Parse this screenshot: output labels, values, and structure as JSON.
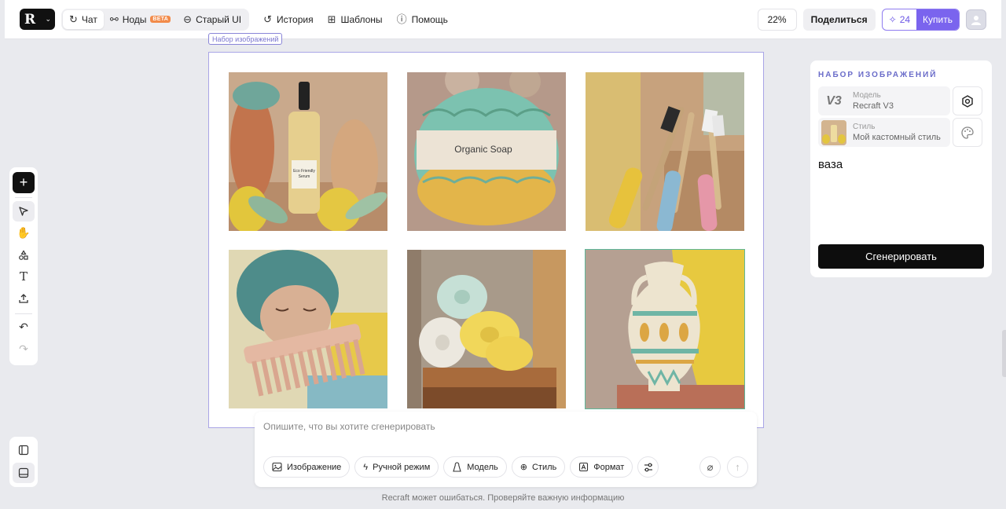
{
  "topbar": {
    "logo_letter": "R",
    "tabs": [
      {
        "label": "Чат",
        "icon": "refresh-icon",
        "active": true
      },
      {
        "label": "Ноды",
        "icon": "nodes-icon",
        "badge": "BETA"
      },
      {
        "label": "Старый UI",
        "icon": "minus-circle-icon"
      }
    ],
    "nav": [
      {
        "label": "История",
        "icon": "history-icon"
      },
      {
        "label": "Шаблоны",
        "icon": "grid-icon"
      },
      {
        "label": "Помощь",
        "icon": "help-icon"
      }
    ],
    "zoom": "22%",
    "share_label": "Поделиться",
    "credits": "24",
    "buy_label": "Купить"
  },
  "canvas": {
    "frame_label": "Набор изображений",
    "tiles": [
      {
        "name": "serum",
        "label": "Eco Friendly Serum"
      },
      {
        "name": "soap",
        "label": "Organic Soap"
      },
      {
        "name": "toothbrushes"
      },
      {
        "name": "comb"
      },
      {
        "name": "towels"
      },
      {
        "name": "vase",
        "selected": true
      }
    ]
  },
  "panel": {
    "title": "НАБОР ИЗОБРАЖЕНИЙ",
    "model": {
      "label": "Модель",
      "value": "Recraft V3",
      "badge": "V3"
    },
    "style": {
      "label": "Стиль",
      "value": "Мой кастомный стиль"
    },
    "prompt": "ваза",
    "generate_label": "Сгенерировать"
  },
  "composer": {
    "placeholder": "Опишите, что вы хотите сгенерировать",
    "chips": [
      {
        "label": "Изображение",
        "icon": "image-icon"
      },
      {
        "label": "Ручной режим",
        "icon": "lightning-icon"
      },
      {
        "label": "Модель",
        "icon": "model-icon"
      },
      {
        "label": "Стиль",
        "icon": "plus-circle-icon"
      },
      {
        "label": "Формат",
        "icon": "format-icon"
      }
    ]
  },
  "footer_note": "Recraft может ошибаться. Проверяйте важную информацию"
}
